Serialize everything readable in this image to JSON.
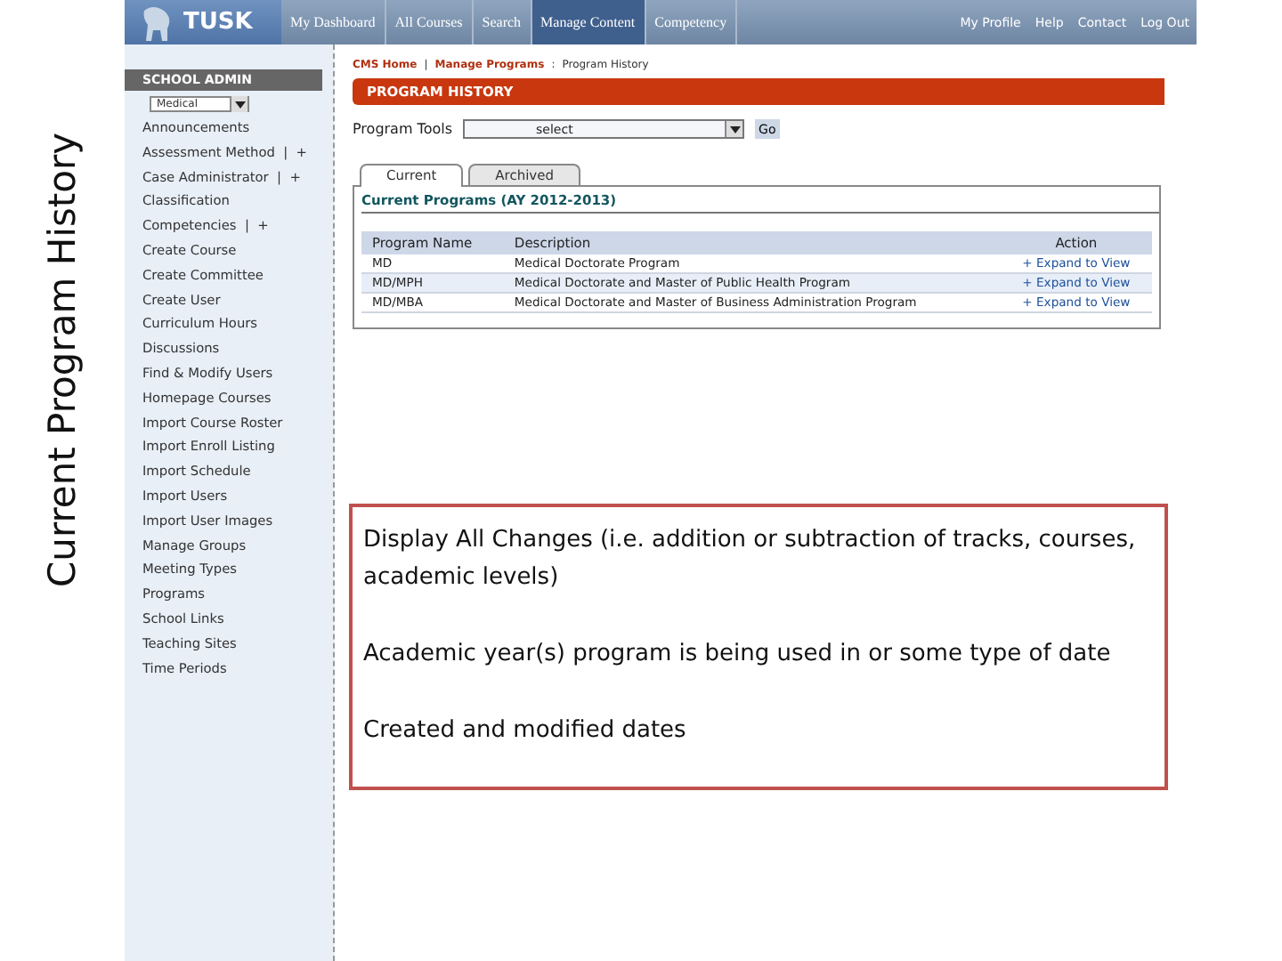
{
  "slide_title": "Current Program History",
  "nav": {
    "logo": "TUSK",
    "items": [
      {
        "label": "My Dashboard",
        "selected": false
      },
      {
        "label": "All Courses",
        "selected": false
      },
      {
        "label": "Search",
        "selected": false
      },
      {
        "label": "Manage Content",
        "selected": true
      },
      {
        "label": "Competency",
        "selected": false
      }
    ],
    "right_links": [
      "My Profile",
      "Help",
      "Contact",
      "Log Out"
    ]
  },
  "sidebar": {
    "heading": "SCHOOL ADMIN",
    "school_select": "Medical",
    "items": [
      {
        "label": "Announcements"
      },
      {
        "label": "Assessment Method  |  +"
      },
      {
        "label": "Case Administrator  |  +"
      },
      {
        "label": "Classification"
      },
      {
        "label": "Competencies  |  +"
      },
      {
        "label": "Create Course"
      },
      {
        "label": "Create Committee"
      },
      {
        "label": "Create User"
      },
      {
        "label": "Curriculum Hours"
      },
      {
        "label": "Discussions"
      },
      {
        "label": "Find & Modify Users"
      },
      {
        "label": "Homepage Courses"
      },
      {
        "label": "Import Course Roster"
      },
      {
        "label": "Import Enroll Listing"
      },
      {
        "label": "Import Schedule"
      },
      {
        "label": "Import Users"
      },
      {
        "label": "Import User Images"
      },
      {
        "label": "Manage Groups"
      },
      {
        "label": "Meeting Types"
      },
      {
        "label": "Programs"
      },
      {
        "label": "School Links"
      },
      {
        "label": "Teaching Sites"
      },
      {
        "label": "Time Periods"
      }
    ]
  },
  "breadcrumb": {
    "links": [
      "CMS Home",
      "Manage Programs"
    ],
    "separators": [
      "|",
      ":"
    ],
    "current": "Program History"
  },
  "page_heading": "PROGRAM HISTORY",
  "program_tools": {
    "label": "Program Tools",
    "select": "select",
    "button": "Go"
  },
  "tabs": [
    {
      "label": "Current",
      "selected": true
    },
    {
      "label": "Archived",
      "selected": false
    }
  ],
  "section_title": "Current Programs (AY 2012-2013)",
  "table": {
    "columns": [
      "Program Name",
      "Description",
      "Action"
    ],
    "rows": [
      {
        "name": "MD",
        "description": "Medical Doctorate Program",
        "action": "+ Expand to View"
      },
      {
        "name": "MD/MPH",
        "description": "Medical Doctorate and Master of Public Health Program",
        "action": "+ Expand to View"
      },
      {
        "name": "MD/MBA",
        "description": "Medical Doctorate and Master of Business Administration Program",
        "action": "+ Expand to View"
      }
    ]
  },
  "callout": [
    "Display All Changes (i.e. addition or subtraction of tracks, courses, academic levels)",
    "Academic year(s) program is being used in or some type of date",
    "Created and modified dates"
  ]
}
